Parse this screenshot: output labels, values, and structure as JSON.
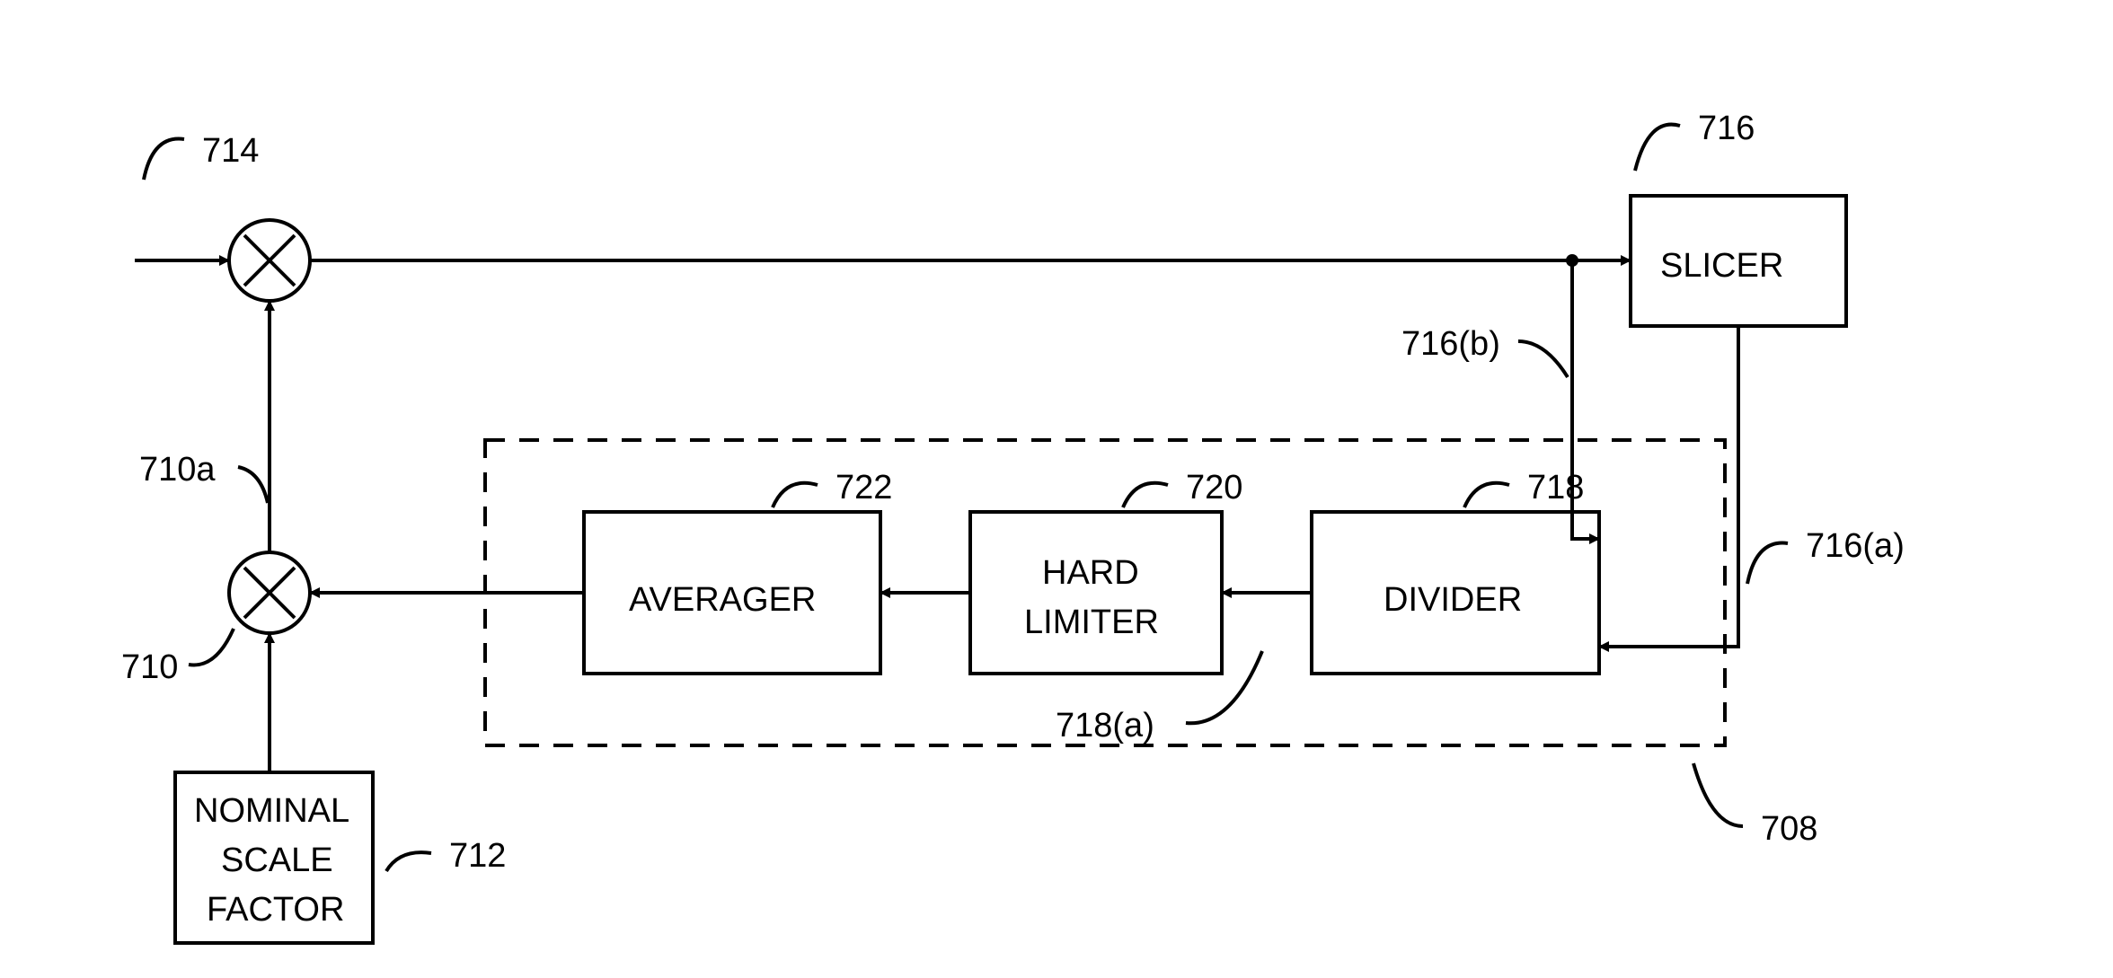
{
  "diagram": {
    "slicer": {
      "label": "SLICER",
      "ref": "716"
    },
    "divider": {
      "label": "DIVIDER",
      "ref": "718"
    },
    "limiter": {
      "label_line1": "HARD",
      "label_line2": "LIMITER",
      "ref": "720"
    },
    "averager": {
      "label": "AVERAGER",
      "ref": "722"
    },
    "scale": {
      "label_line1": "NOMINAL",
      "label_line2": "SCALE",
      "label_line3": "FACTOR",
      "ref": "712"
    },
    "feedback_box": {
      "ref": "708"
    },
    "mult_upper": {
      "ref": "714"
    },
    "mult_lower": {
      "ref": "710"
    },
    "signals": {
      "slicer_out_a": "716(a)",
      "slicer_in_b": "716(b)",
      "divider_out": "718(a)",
      "mult_out_a": "710a"
    }
  }
}
